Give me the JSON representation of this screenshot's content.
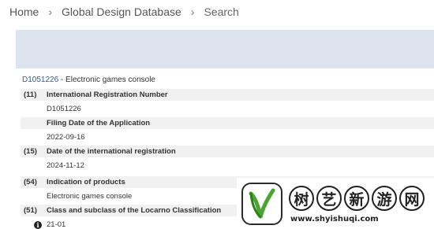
{
  "breadcrumb": [
    "Home",
    "Global Design Database",
    "Search"
  ],
  "record": {
    "id": "D1051226",
    "separator": " - ",
    "title": "Electronic games console"
  },
  "fields": [
    {
      "code": "(11)",
      "label": "International Registration Number",
      "value": "D1051226"
    },
    {
      "code": "",
      "label": "Filing Date of the Application",
      "value": "2022-09-16"
    },
    {
      "code": "(15)",
      "label": "Date of the international registration",
      "value": "2024-11-12"
    },
    {
      "code": "(54)",
      "label": "Indication of products",
      "value": "Electronic games console"
    },
    {
      "code": "(51)",
      "label": "Class and subclass of the Locarno Classification",
      "value": "21-01"
    }
  ],
  "icons": {
    "info": "info-icon"
  },
  "watermark": {
    "chars": [
      "树",
      "艺",
      "新",
      "游",
      "网"
    ],
    "url": "www.shyishuqi.com"
  },
  "colors": {
    "banner": "#dde4f0",
    "link": "#2f5f9e",
    "field_header_bg": "#f1f1f1"
  }
}
